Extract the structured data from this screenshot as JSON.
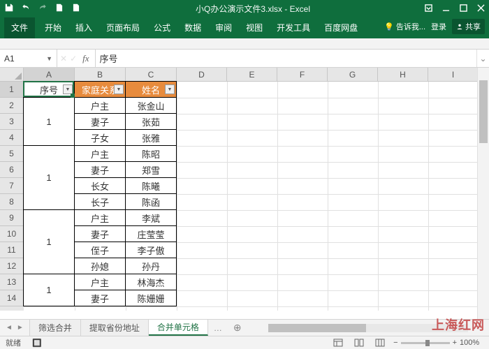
{
  "title": "小Q办公演示文件3.xlsx - Excel",
  "ribbon": {
    "file": "文件",
    "tabs": [
      "开始",
      "插入",
      "页面布局",
      "公式",
      "数据",
      "审阅",
      "视图",
      "开发工具",
      "百度网盘"
    ],
    "tell_me": "告诉我...",
    "signin": "登录",
    "share": "共享"
  },
  "namebox": "A1",
  "formula": "序号",
  "columns": [
    "A",
    "B",
    "C",
    "D",
    "E",
    "F",
    "G",
    "H",
    "I"
  ],
  "row_numbers": [
    1,
    2,
    3,
    4,
    5,
    6,
    7,
    8,
    9,
    10,
    11,
    12,
    13,
    14
  ],
  "headers": {
    "a": "序号",
    "b": "家庭关系",
    "c": "姓名"
  },
  "rows": [
    {
      "b": "户主",
      "c": "张金山"
    },
    {
      "b": "妻子",
      "c": "张茹"
    },
    {
      "b": "子女",
      "c": "张雅"
    },
    {
      "b": "户主",
      "c": "陈昭"
    },
    {
      "b": "妻子",
      "c": "郑雪"
    },
    {
      "b": "长女",
      "c": "陈曦"
    },
    {
      "b": "长子",
      "c": "陈函"
    },
    {
      "b": "户主",
      "c": "李斌"
    },
    {
      "b": "妻子",
      "c": "庄莹莹"
    },
    {
      "b": "侄子",
      "c": "李子傲"
    },
    {
      "b": "孙媳",
      "c": "孙丹"
    },
    {
      "b": "户主",
      "c": "林海杰"
    },
    {
      "b": "妻子",
      "c": "陈姗姗"
    }
  ],
  "merges": [
    {
      "start": 1,
      "span": 3,
      "val": "1"
    },
    {
      "start": 4,
      "span": 4,
      "val": "1"
    },
    {
      "start": 8,
      "span": 4,
      "val": "1"
    },
    {
      "start": 12,
      "span": 3,
      "val": "1"
    }
  ],
  "sheets": {
    "tabs": [
      "筛选合并",
      "提取省份地址",
      "合并单元格"
    ],
    "active": 2
  },
  "status": {
    "ready": "就绪",
    "extra": "",
    "zoom": "100%"
  },
  "watermark": "上海红网"
}
